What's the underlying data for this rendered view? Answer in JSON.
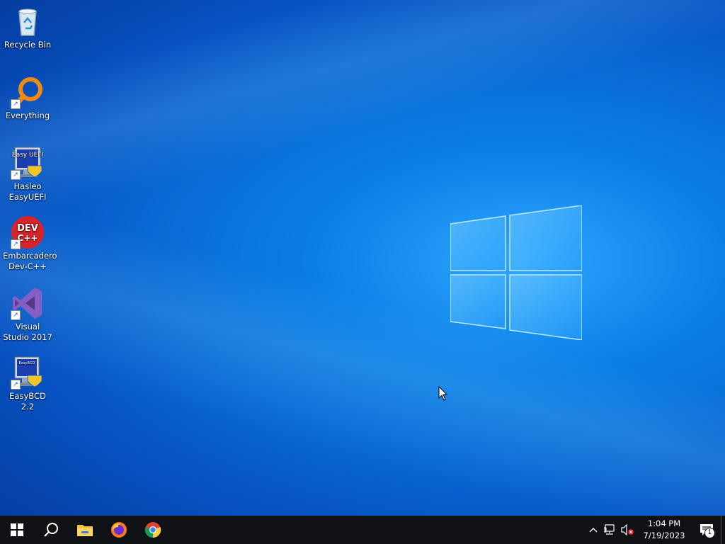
{
  "desktop": {
    "icons": [
      {
        "label": "Recycle Bin",
        "icon": "recycle-bin-icon"
      },
      {
        "label": "Everything",
        "icon": "everything-search-icon"
      },
      {
        "label": "Hasleo EasyUEFI",
        "icon": "easyuefi-icon",
        "badge": "Easy UEFI"
      },
      {
        "label": "Embarcadero Dev-C++",
        "icon": "devcpp-icon",
        "badge_line1": "DEV",
        "badge_line2": "C++"
      },
      {
        "label": "Visual Studio 2017",
        "icon": "visual-studio-icon"
      },
      {
        "label": "EasyBCD 2.2",
        "icon": "easybcd-icon",
        "badge": "EasyBCD"
      }
    ]
  },
  "taskbar": {
    "pinned": [
      "start-icon",
      "search-icon",
      "file-explorer-icon",
      "firefox-icon",
      "chrome-icon"
    ],
    "tray": {
      "time": "1:04 PM",
      "date": "7/19/2023",
      "notification_count": "1"
    }
  },
  "colors": {
    "taskbar": "#0f1115",
    "accent": "#0a7fe6"
  }
}
